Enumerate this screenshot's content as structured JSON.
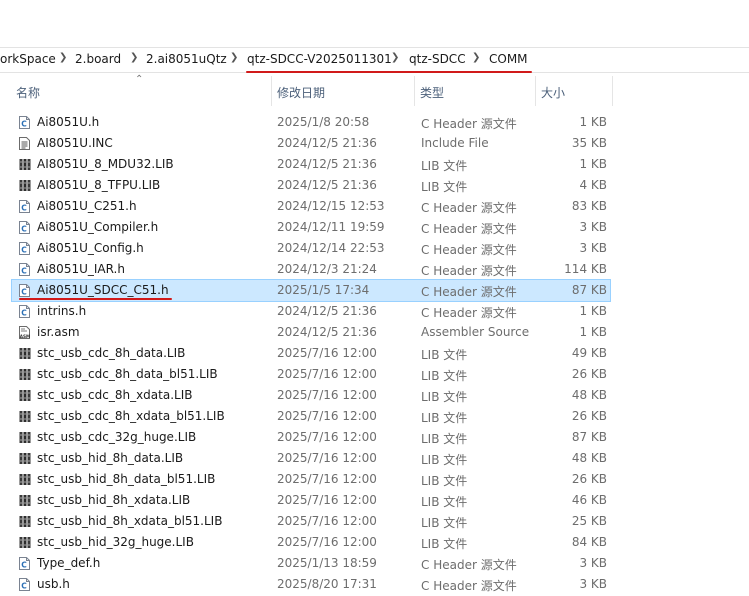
{
  "breadcrumb": [
    "orkSpace",
    "2.board",
    "2.ai8051uQtz",
    "qtz-SDCC-V2025011301",
    "qtz-SDCC",
    "COMM"
  ],
  "columns": {
    "name": "名称",
    "date": "修改日期",
    "type": "类型",
    "size": "大小"
  },
  "files": [
    {
      "name": "Ai8051U.h",
      "date": "2025/1/8 20:58",
      "type": "C Header 源文件",
      "size": "1 KB",
      "icon": "c-header-icon"
    },
    {
      "name": "AI8051U.INC",
      "date": "2024/12/5 21:36",
      "type": "Include File",
      "size": "35 KB",
      "icon": "text-file-icon"
    },
    {
      "name": "AI8051U_8_MDU32.LIB",
      "date": "2024/12/5 21:36",
      "type": "LIB 文件",
      "size": "1 KB",
      "icon": "lib-file-icon"
    },
    {
      "name": "AI8051U_8_TFPU.LIB",
      "date": "2024/12/5 21:36",
      "type": "LIB 文件",
      "size": "4 KB",
      "icon": "lib-file-icon"
    },
    {
      "name": "Ai8051U_C251.h",
      "date": "2024/12/15 12:53",
      "type": "C Header 源文件",
      "size": "83 KB",
      "icon": "c-header-icon"
    },
    {
      "name": "Ai8051U_Compiler.h",
      "date": "2024/12/11 19:59",
      "type": "C Header 源文件",
      "size": "3 KB",
      "icon": "c-header-icon"
    },
    {
      "name": "Ai8051U_Config.h",
      "date": "2024/12/14 22:53",
      "type": "C Header 源文件",
      "size": "3 KB",
      "icon": "c-header-icon"
    },
    {
      "name": "Ai8051U_IAR.h",
      "date": "2024/12/3 21:24",
      "type": "C Header 源文件",
      "size": "114 KB",
      "icon": "c-header-icon"
    },
    {
      "name": "Ai8051U_SDCC_C51.h",
      "date": "2025/1/5 17:34",
      "type": "C Header 源文件",
      "size": "87 KB",
      "icon": "c-header-icon"
    },
    {
      "name": "intrins.h",
      "date": "2024/12/5 21:36",
      "type": "C Header 源文件",
      "size": "1 KB",
      "icon": "c-header-icon"
    },
    {
      "name": "isr.asm",
      "date": "2024/12/5 21:36",
      "type": "Assembler Source",
      "size": "1 KB",
      "icon": "asm-file-icon"
    },
    {
      "name": "stc_usb_cdc_8h_data.LIB",
      "date": "2025/7/16 12:00",
      "type": "LIB 文件",
      "size": "49 KB",
      "icon": "lib-file-icon"
    },
    {
      "name": "stc_usb_cdc_8h_data_bl51.LIB",
      "date": "2025/7/16 12:00",
      "type": "LIB 文件",
      "size": "26 KB",
      "icon": "lib-file-icon"
    },
    {
      "name": "stc_usb_cdc_8h_xdata.LIB",
      "date": "2025/7/16 12:00",
      "type": "LIB 文件",
      "size": "48 KB",
      "icon": "lib-file-icon"
    },
    {
      "name": "stc_usb_cdc_8h_xdata_bl51.LIB",
      "date": "2025/7/16 12:00",
      "type": "LIB 文件",
      "size": "26 KB",
      "icon": "lib-file-icon"
    },
    {
      "name": "stc_usb_cdc_32g_huge.LIB",
      "date": "2025/7/16 12:00",
      "type": "LIB 文件",
      "size": "87 KB",
      "icon": "lib-file-icon"
    },
    {
      "name": "stc_usb_hid_8h_data.LIB",
      "date": "2025/7/16 12:00",
      "type": "LIB 文件",
      "size": "48 KB",
      "icon": "lib-file-icon"
    },
    {
      "name": "stc_usb_hid_8h_data_bl51.LIB",
      "date": "2025/7/16 12:00",
      "type": "LIB 文件",
      "size": "26 KB",
      "icon": "lib-file-icon"
    },
    {
      "name": "stc_usb_hid_8h_xdata.LIB",
      "date": "2025/7/16 12:00",
      "type": "LIB 文件",
      "size": "46 KB",
      "icon": "lib-file-icon"
    },
    {
      "name": "stc_usb_hid_8h_xdata_bl51.LIB",
      "date": "2025/7/16 12:00",
      "type": "LIB 文件",
      "size": "25 KB",
      "icon": "lib-file-icon"
    },
    {
      "name": "stc_usb_hid_32g_huge.LIB",
      "date": "2025/7/16 12:00",
      "type": "LIB 文件",
      "size": "84 KB",
      "icon": "lib-file-icon"
    },
    {
      "name": "Type_def.h",
      "date": "2025/1/13 18:59",
      "type": "C Header 源文件",
      "size": "3 KB",
      "icon": "c-header-icon"
    },
    {
      "name": "usb.h",
      "date": "2025/8/20 17:31",
      "type": "C Header 源文件",
      "size": "3 KB",
      "icon": "c-header-icon"
    }
  ],
  "selected_file": "Ai8051U_SDCC_C51.h",
  "colors": {
    "selection": "#cce8ff",
    "selection_border": "#99d1ff",
    "annotation": "#d11a1a",
    "header_text": "#4c607a"
  }
}
